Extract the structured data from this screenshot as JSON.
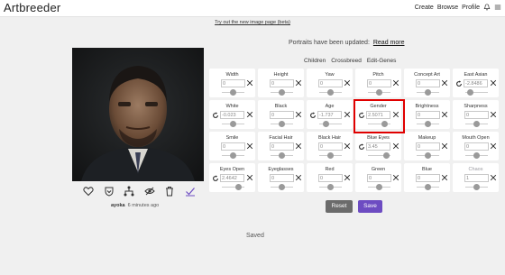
{
  "header": {
    "logo": "Artbreeder",
    "nav": [
      "Create",
      "Browse",
      "Profile"
    ]
  },
  "banner_link": "Try out the new image page (beta)",
  "updated_notice": {
    "text": "Portraits have been updated:",
    "link": "Read more"
  },
  "tabs": [
    "Children",
    "Crossbreed",
    "Edit-Genes"
  ],
  "image": {
    "author": "ayoka",
    "time": "6 minutes ago"
  },
  "genes": [
    {
      "label": "Width",
      "value": "0",
      "reset": false,
      "slider": 0.5
    },
    {
      "label": "Height",
      "value": "0",
      "reset": false,
      "slider": 0.5
    },
    {
      "label": "Yaw",
      "value": "0",
      "reset": false,
      "slider": 0.5
    },
    {
      "label": "Pitch",
      "value": "0",
      "reset": false,
      "slider": 0.5
    },
    {
      "label": "Concept Art",
      "value": "0",
      "reset": false,
      "slider": 0.5
    },
    {
      "label": "East Asian",
      "value": "-2.8486",
      "reset": true,
      "slider": 0.22
    },
    {
      "label": "White",
      "value": "-0.023",
      "reset": true,
      "slider": 0.5
    },
    {
      "label": "Black",
      "value": "0",
      "reset": false,
      "slider": 0.5
    },
    {
      "label": "Age",
      "value": "-1.737",
      "reset": true,
      "slider": 0.3
    },
    {
      "label": "Gender",
      "value": "2.5071",
      "reset": true,
      "slider": 0.75
    },
    {
      "label": "Brightness",
      "value": "0",
      "reset": false,
      "slider": 0.5
    },
    {
      "label": "Sharpness",
      "value": "0",
      "reset": false,
      "slider": 0.5
    },
    {
      "label": "Smile",
      "value": "0",
      "reset": false,
      "slider": 0.5
    },
    {
      "label": "Facial Hair",
      "value": "0",
      "reset": false,
      "slider": 0.5
    },
    {
      "label": "Black Hair",
      "value": "0",
      "reset": false,
      "slider": 0.5
    },
    {
      "label": "Blue Eyes",
      "value": "3.45",
      "reset": true,
      "slider": 0.82
    },
    {
      "label": "Makeup",
      "value": "0",
      "reset": false,
      "slider": 0.5
    },
    {
      "label": "Mouth Open",
      "value": "0",
      "reset": false,
      "slider": 0.5
    },
    {
      "label": "Eyes Open",
      "value": "2.4642",
      "reset": true,
      "slider": 0.74
    },
    {
      "label": "Eyeglasses",
      "value": "0",
      "reset": false,
      "slider": 0.5
    },
    {
      "label": "Red",
      "value": "0",
      "reset": false,
      "slider": 0.5
    },
    {
      "label": "Green",
      "value": "0",
      "reset": false,
      "slider": 0.5
    },
    {
      "label": "Blue",
      "value": "0",
      "reset": false,
      "slider": 0.5
    },
    {
      "label": "Chaos",
      "value": "1",
      "reset": false,
      "slider": 0.5,
      "dim": true
    }
  ],
  "buttons": {
    "reset": "Reset",
    "save": "Save"
  },
  "status": "Saved",
  "colors": {
    "accent": "#6d4cc2",
    "highlight": "#e00000",
    "reset_button": "#6b6b6b"
  }
}
